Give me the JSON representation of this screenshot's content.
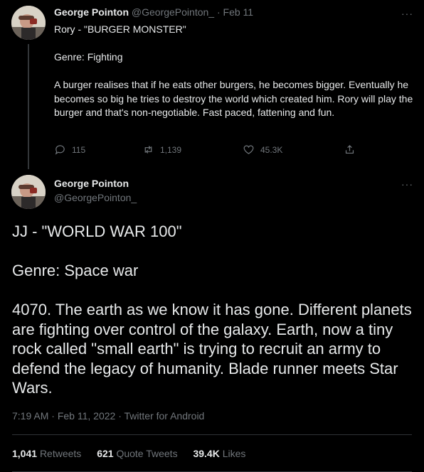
{
  "tweet1": {
    "author_name": "George Pointon",
    "author_handle": "@GeorgePointon_",
    "separator": "·",
    "date": "Feb 11",
    "more_label": "···",
    "lines": [
      "Rory - \"BURGER MONSTER\"",
      "",
      "Genre: Fighting",
      "",
      "A burger realises that if he eats other burgers, he becomes bigger. Eventually he becomes so big he tries to destroy the world which created him. Rory will play the burger and that's non-negotiable. Fast paced, fattening and fun."
    ],
    "actions": {
      "reply_count": "115",
      "retweet_count": "1,139",
      "like_count": "45.3K",
      "share_icon": "share-icon"
    }
  },
  "tweet2": {
    "author_name": "George Pointon",
    "author_handle": "@GeorgePointon_",
    "more_label": "···",
    "lines": [
      "JJ - \"WORLD WAR 100\"",
      "",
      "Genre: Space war",
      "",
      "4070. The earth as we know it has gone. Different planets are fighting over control of the galaxy. Earth, now a tiny rock called \"small earth\" is trying to recruit an army to defend the legacy of humanity. Blade runner meets Star Wars."
    ],
    "meta": {
      "time": "7:19 AM",
      "date": "Feb 11, 2022",
      "source": "Twitter for Android",
      "separator": "·"
    },
    "stats": {
      "retweets_count": "1,041",
      "retweets_label": "Retweets",
      "quote_count": "621",
      "quote_label": "Quote Tweets",
      "likes_count": "39.4K",
      "likes_label": "Likes"
    }
  },
  "colors": {
    "background": "#000000",
    "text": "#e7e9ea",
    "muted": "#71767b",
    "divider": "#2f3336"
  }
}
